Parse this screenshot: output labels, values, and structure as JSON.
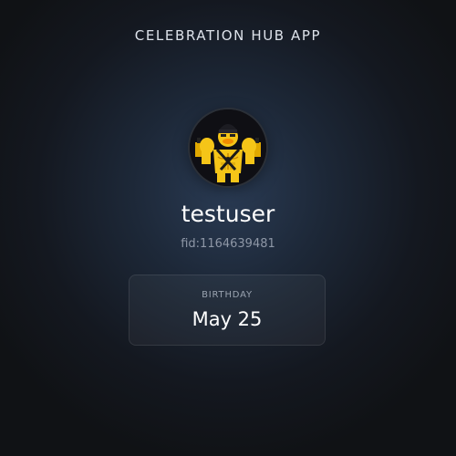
{
  "header": {
    "title": "CELEBRATION HUB APP"
  },
  "profile": {
    "avatar_icon": "muscular-duck-avatar-icon",
    "username": "testuser",
    "fid": "fid:1164639481"
  },
  "birthday": {
    "label": "BIRTHDAY",
    "value": "May 25"
  },
  "colors": {
    "background_center": "#2a3b54",
    "background_edge": "#101215",
    "text_primary": "#ffffff",
    "text_muted": "#8e97a6",
    "avatar_yellow": "#f5c518"
  }
}
